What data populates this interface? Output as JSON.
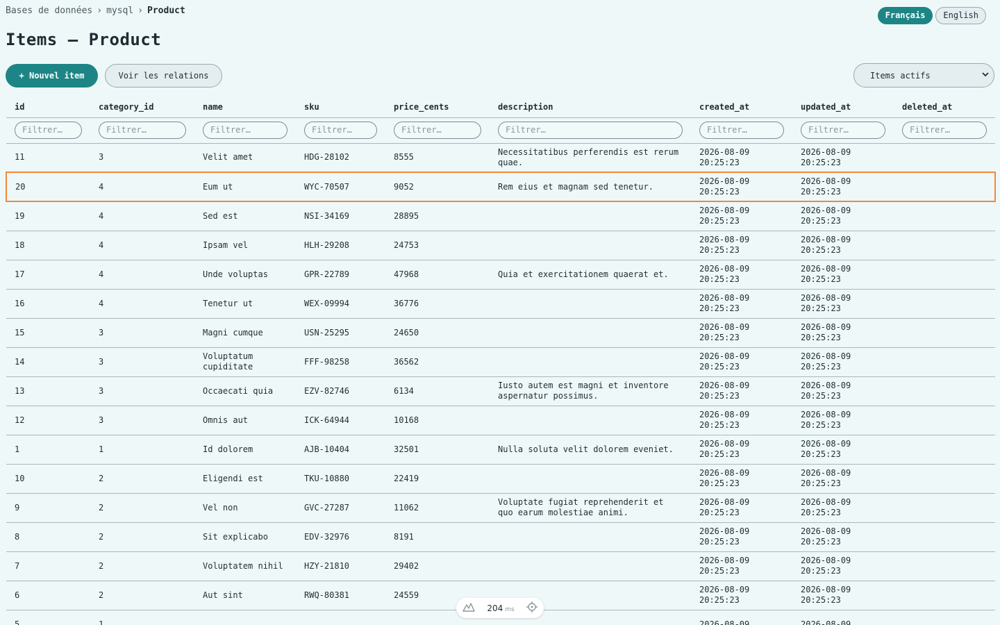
{
  "breadcrumb": [
    "Bases de données",
    "mysql",
    "Product"
  ],
  "languages": [
    {
      "label": "Français",
      "active": true
    },
    {
      "label": "English",
      "active": false
    }
  ],
  "title": "Items — Product",
  "actions": {
    "new_item": "+ Nouvel item",
    "relations": "Voir les relations"
  },
  "scope_select": {
    "value": "Items actifs"
  },
  "filter_placeholder": "Filtrer…",
  "columns": [
    "id",
    "category_id",
    "name",
    "sku",
    "price_cents",
    "description",
    "created_at",
    "updated_at",
    "deleted_at"
  ],
  "rows": [
    {
      "id": "11",
      "category_id": "3",
      "name": "Velit amet",
      "sku": "HDG-28102",
      "price_cents": "8555",
      "description": "Necessitatibus perferendis est rerum quae.",
      "created_at": "2026-08-09 20:25:23",
      "updated_at": "2026-08-09 20:25:23",
      "deleted_at": ""
    },
    {
      "id": "20",
      "category_id": "4",
      "name": "Eum ut",
      "sku": "WYC-70507",
      "price_cents": "9052",
      "description": "Rem eius et magnam sed tenetur.",
      "created_at": "2026-08-09 20:25:23",
      "updated_at": "2026-08-09 20:25:23",
      "deleted_at": "",
      "selected": true
    },
    {
      "id": "19",
      "category_id": "4",
      "name": "Sed est",
      "sku": "NSI-34169",
      "price_cents": "28895",
      "description": "",
      "created_at": "2026-08-09 20:25:23",
      "updated_at": "2026-08-09 20:25:23",
      "deleted_at": ""
    },
    {
      "id": "18",
      "category_id": "4",
      "name": "Ipsam vel",
      "sku": "HLH-29208",
      "price_cents": "24753",
      "description": "",
      "created_at": "2026-08-09 20:25:23",
      "updated_at": "2026-08-09 20:25:23",
      "deleted_at": ""
    },
    {
      "id": "17",
      "category_id": "4",
      "name": "Unde voluptas",
      "sku": "GPR-22789",
      "price_cents": "47968",
      "description": "Quia et exercitationem quaerat et.",
      "created_at": "2026-08-09 20:25:23",
      "updated_at": "2026-08-09 20:25:23",
      "deleted_at": ""
    },
    {
      "id": "16",
      "category_id": "4",
      "name": "Tenetur ut",
      "sku": "WEX-09994",
      "price_cents": "36776",
      "description": "",
      "created_at": "2026-08-09 20:25:23",
      "updated_at": "2026-08-09 20:25:23",
      "deleted_at": ""
    },
    {
      "id": "15",
      "category_id": "3",
      "name": "Magni cumque",
      "sku": "USN-25295",
      "price_cents": "24650",
      "description": "",
      "created_at": "2026-08-09 20:25:23",
      "updated_at": "2026-08-09 20:25:23",
      "deleted_at": ""
    },
    {
      "id": "14",
      "category_id": "3",
      "name": "Voluptatum cupiditate",
      "sku": "FFF-98258",
      "price_cents": "36562",
      "description": "",
      "created_at": "2026-08-09 20:25:23",
      "updated_at": "2026-08-09 20:25:23",
      "deleted_at": ""
    },
    {
      "id": "13",
      "category_id": "3",
      "name": "Occaecati quia",
      "sku": "EZV-82746",
      "price_cents": "6134",
      "description": "Iusto autem est magni et inventore aspernatur possimus.",
      "created_at": "2026-08-09 20:25:23",
      "updated_at": "2026-08-09 20:25:23",
      "deleted_at": ""
    },
    {
      "id": "12",
      "category_id": "3",
      "name": "Omnis aut",
      "sku": "ICK-64944",
      "price_cents": "10168",
      "description": "",
      "created_at": "2026-08-09 20:25:23",
      "updated_at": "2026-08-09 20:25:23",
      "deleted_at": ""
    },
    {
      "id": "1",
      "category_id": "1",
      "name": "Id dolorem",
      "sku": "AJB-10404",
      "price_cents": "32501",
      "description": "Nulla soluta velit dolorem eveniet.",
      "created_at": "2026-08-09 20:25:23",
      "updated_at": "2026-08-09 20:25:23",
      "deleted_at": ""
    },
    {
      "id": "10",
      "category_id": "2",
      "name": "Eligendi est",
      "sku": "TKU-10880",
      "price_cents": "22419",
      "description": "",
      "created_at": "2026-08-09 20:25:23",
      "updated_at": "2026-08-09 20:25:23",
      "deleted_at": ""
    },
    {
      "id": "9",
      "category_id": "2",
      "name": "Vel non",
      "sku": "GVC-27287",
      "price_cents": "11062",
      "description": "Voluptate fugiat reprehenderit et quo earum molestiae animi.",
      "created_at": "2026-08-09 20:25:23",
      "updated_at": "2026-08-09 20:25:23",
      "deleted_at": ""
    },
    {
      "id": "8",
      "category_id": "2",
      "name": "Sit explicabo",
      "sku": "EDV-32976",
      "price_cents": "8191",
      "description": "",
      "created_at": "2026-08-09 20:25:23",
      "updated_at": "2026-08-09 20:25:23",
      "deleted_at": ""
    },
    {
      "id": "7",
      "category_id": "2",
      "name": "Voluptatem nihil",
      "sku": "HZY-21810",
      "price_cents": "29402",
      "description": "",
      "created_at": "2026-08-09 20:25:23",
      "updated_at": "2026-08-09 20:25:23",
      "deleted_at": ""
    },
    {
      "id": "6",
      "category_id": "2",
      "name": "Aut sint",
      "sku": "RWQ-80381",
      "price_cents": "24559",
      "description": "",
      "created_at": "2026-08-09 20:25:23",
      "updated_at": "2026-08-09 20:25:23",
      "deleted_at": ""
    },
    {
      "id": "5",
      "category_id": "1",
      "name": "",
      "sku": "",
      "price_cents": "",
      "description": "",
      "created_at": "2026-08-09",
      "updated_at": "2026-08-09",
      "deleted_at": ""
    }
  ],
  "perf_badge": {
    "value": "204",
    "unit": "ms",
    "icons": [
      "logo-icon",
      "target-icon"
    ]
  },
  "colors": {
    "accent": "#1d8585",
    "selection": "#f0883a",
    "background": "#eef8f8"
  }
}
